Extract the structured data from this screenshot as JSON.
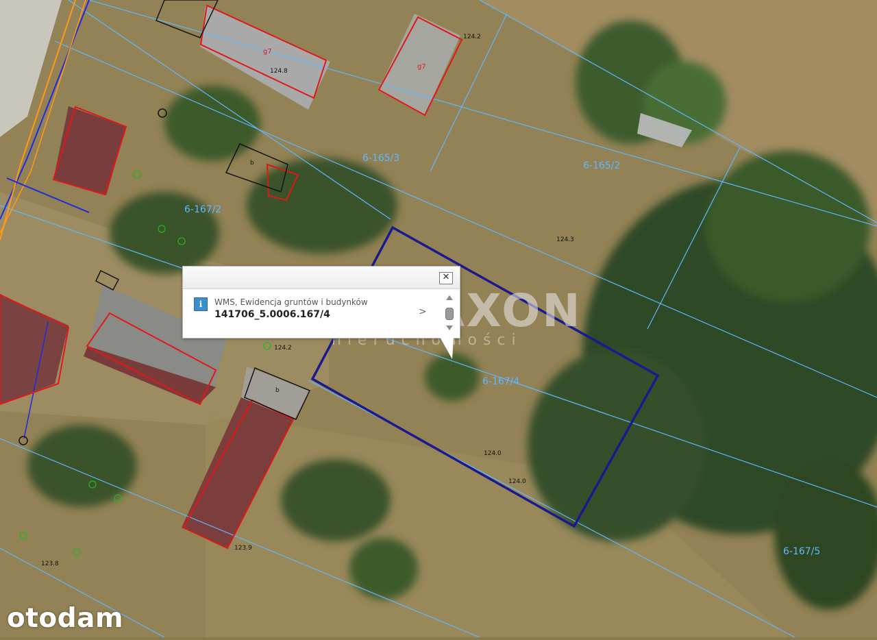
{
  "popup": {
    "layer_name": "WMS, Ewidencja gruntów i budynków",
    "parcel_id": "141706_5.0006.167/4",
    "close_label": "✕",
    "next_label": ">",
    "info_label": "i"
  },
  "map": {
    "parcel_labels": [
      "6-165/3",
      "6-165/2",
      "6-167/2",
      "6-167/4",
      "6-167/5"
    ],
    "elevation_labels": [
      "124.2",
      "124.8",
      "124.3",
      "124.2",
      "124.0",
      "124.0",
      "123.9",
      "123.8"
    ],
    "building_codes": [
      "g7",
      "g7",
      "b",
      "b"
    ],
    "highlight_color": "#1a1a8c",
    "parcel_line_color": "#5fb8ff",
    "building_color": "#e01818"
  },
  "watermark": {
    "main": "MAXON",
    "sub": "nieruchomości"
  },
  "brand": {
    "name": "otodam"
  }
}
